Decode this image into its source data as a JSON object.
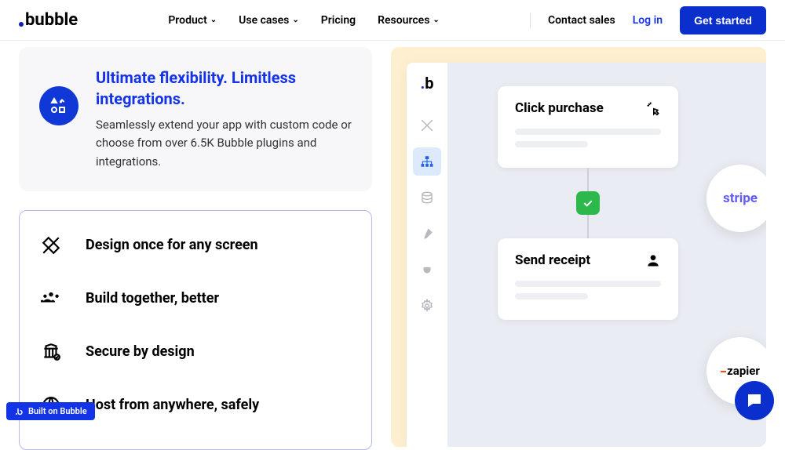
{
  "nav": {
    "logo": "bubble",
    "items": [
      {
        "label": "Product",
        "hasDropdown": true
      },
      {
        "label": "Use cases",
        "hasDropdown": true
      },
      {
        "label": "Pricing",
        "hasDropdown": false
      },
      {
        "label": "Resources",
        "hasDropdown": true
      }
    ],
    "contact": "Contact sales",
    "login": "Log in",
    "cta": "Get started"
  },
  "feature_card": {
    "title": "Ultimate flexibility. Limitless integrations.",
    "body": "Seamlessly extend your app with custom code or choose from over 6.5K Bubble plugins and integrations."
  },
  "feature_list": [
    {
      "icon": "design",
      "text": "Design once for any screen"
    },
    {
      "icon": "team",
      "text": "Build together, better"
    },
    {
      "icon": "secure",
      "text": "Secure by design"
    },
    {
      "icon": "host",
      "text": "Host from anywhere, safely"
    }
  ],
  "workflow": {
    "card1": {
      "title": "Click purchase"
    },
    "card2": {
      "title": "Send receipt"
    },
    "brand1": "stripe",
    "brand2": "zapier"
  },
  "built_badge": "Built on Bubble"
}
